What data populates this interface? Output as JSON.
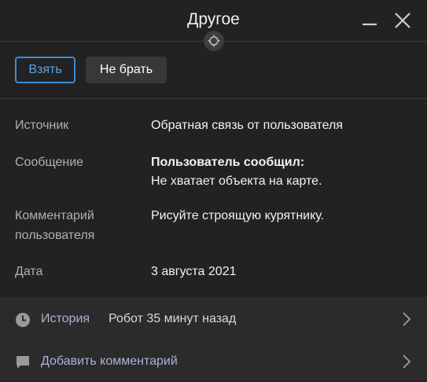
{
  "header": {
    "title": "Другое",
    "minimize_icon": "minimize-icon",
    "close_icon": "close-icon",
    "target_icon": "crosshair-icon"
  },
  "actions": {
    "take_label": "Взять",
    "skip_label": "Не брать"
  },
  "details": [
    {
      "label": "Источник",
      "value": "Обратная связь от пользователя"
    },
    {
      "label": "Сообщение",
      "value_bold": "Пользователь сообщил:",
      "value": "Не хватает объекта на карте."
    },
    {
      "label_line1": "Комментарий",
      "label_line2": "пользователя",
      "value": "Рисуйте строящую курятнику."
    },
    {
      "label": "Дата",
      "value": "3 августа 2021"
    }
  ],
  "footer": {
    "history_label": "История",
    "history_meta": "Робот 35 минут назад",
    "add_comment_label": "Добавить комментарий"
  },
  "colors": {
    "background": "#222222",
    "footer_background": "#2b2b2b",
    "accent": "#3d8ad6",
    "link": "#a8b4d8"
  }
}
